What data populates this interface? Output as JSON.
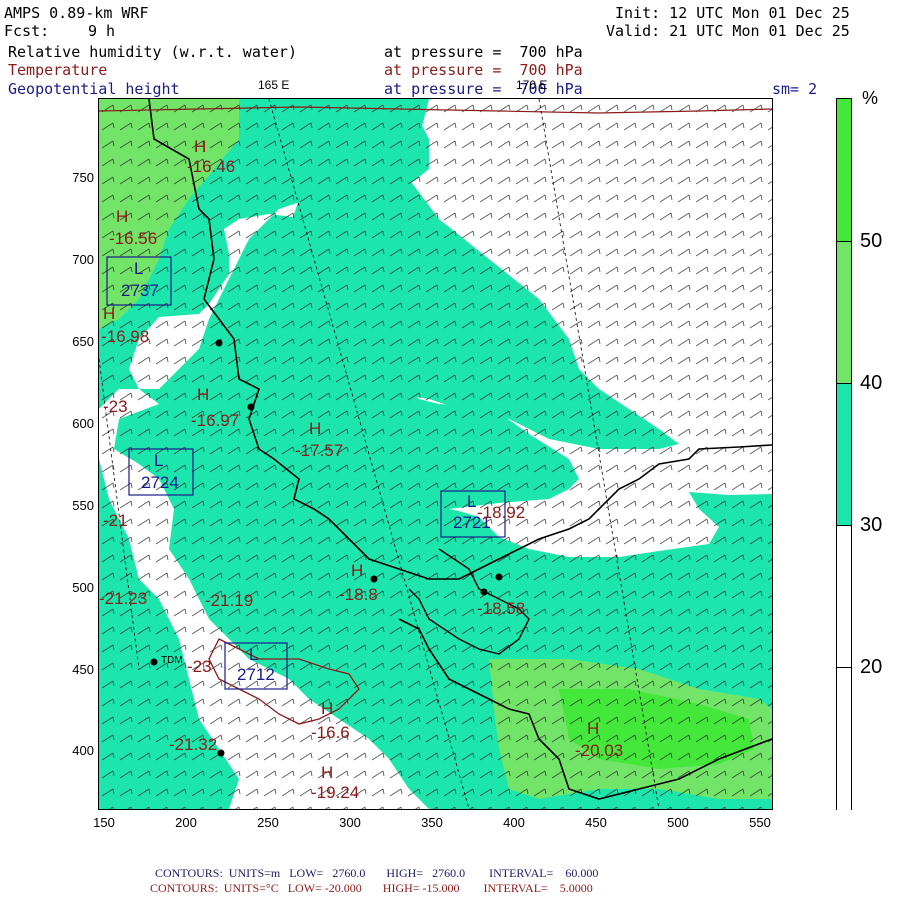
{
  "header": {
    "model": "AMPS 0.89-km WRF",
    "init": "Init: 12 UTC Mon 01 Dec 25",
    "fcst_label": "Fcst:",
    "fcst_value": "9 h",
    "valid": "Valid: 21 UTC Mon 01 Dec 25",
    "fields": [
      {
        "name": "Relative humidity (w.r.t. water)",
        "level": "at pressure =  700 hPa",
        "color": "#000000"
      },
      {
        "name": "Temperature",
        "level": "at pressure =  700 hPa",
        "color": "#8b1a1a"
      },
      {
        "name": "Geopotential height",
        "level": "at pressure =  700 hPa",
        "color": "#1a1a8b"
      }
    ],
    "smoothing": "sm= 2",
    "meridian_165": "165 E",
    "meridian_170": "170 E"
  },
  "axes": {
    "x_ticks": [
      "150",
      "200",
      "250",
      "300",
      "350",
      "400",
      "450",
      "500",
      "550"
    ],
    "y_ticks": [
      "750",
      "700",
      "650",
      "600",
      "550",
      "500",
      "450",
      "400"
    ]
  },
  "colorbar": {
    "unit": "%",
    "labels": [
      "50",
      "40",
      "30",
      "20"
    ],
    "bands": [
      {
        "from": 50,
        "to": 60,
        "color": "#44e83a"
      },
      {
        "from": 40,
        "to": 50,
        "color": "#72e468"
      },
      {
        "from": 30,
        "to": 40,
        "color": "#1de6ac"
      },
      {
        "from": 10,
        "to": 30,
        "color": "#ffffff"
      }
    ]
  },
  "map_labels": {
    "highs": [
      {
        "mark": "H",
        "value": "-16.46"
      },
      {
        "mark": "H",
        "value": "-16.56"
      },
      {
        "mark": "H",
        "value": "-16.98"
      },
      {
        "mark": "H",
        "value": "-16.97"
      },
      {
        "mark": "H",
        "value": "-17.57"
      },
      {
        "mark": "H",
        "value": "-18.8"
      },
      {
        "mark": "H",
        "value": "-16.6"
      },
      {
        "mark": "H",
        "value": "-19.24"
      },
      {
        "mark": "H",
        "value": "-20.03"
      }
    ],
    "lows": [
      {
        "mark": "L",
        "value": "2737"
      },
      {
        "mark": "L",
        "value": "2724"
      },
      {
        "mark": "L",
        "value": "2721"
      },
      {
        "mark": "L",
        "value": "2712"
      }
    ],
    "temps": [
      "-23",
      "-18.92",
      "-18.58",
      "-21.19",
      "-21.23",
      "-23",
      "-21.32",
      "-21"
    ],
    "station": "TDM"
  },
  "footer": {
    "line1": "CONTOURS:  UNITS=m   LOW=   2760.0       HIGH=   2760.0        INTERVAL=    60.000",
    "line2": "CONTOURS:  UNITS=°C   LOW= -20.000       HIGH= -15.000        INTERVAL=    5.0000",
    "line1_color": "#1a1a6b",
    "line2_color": "#8b1a1a"
  }
}
